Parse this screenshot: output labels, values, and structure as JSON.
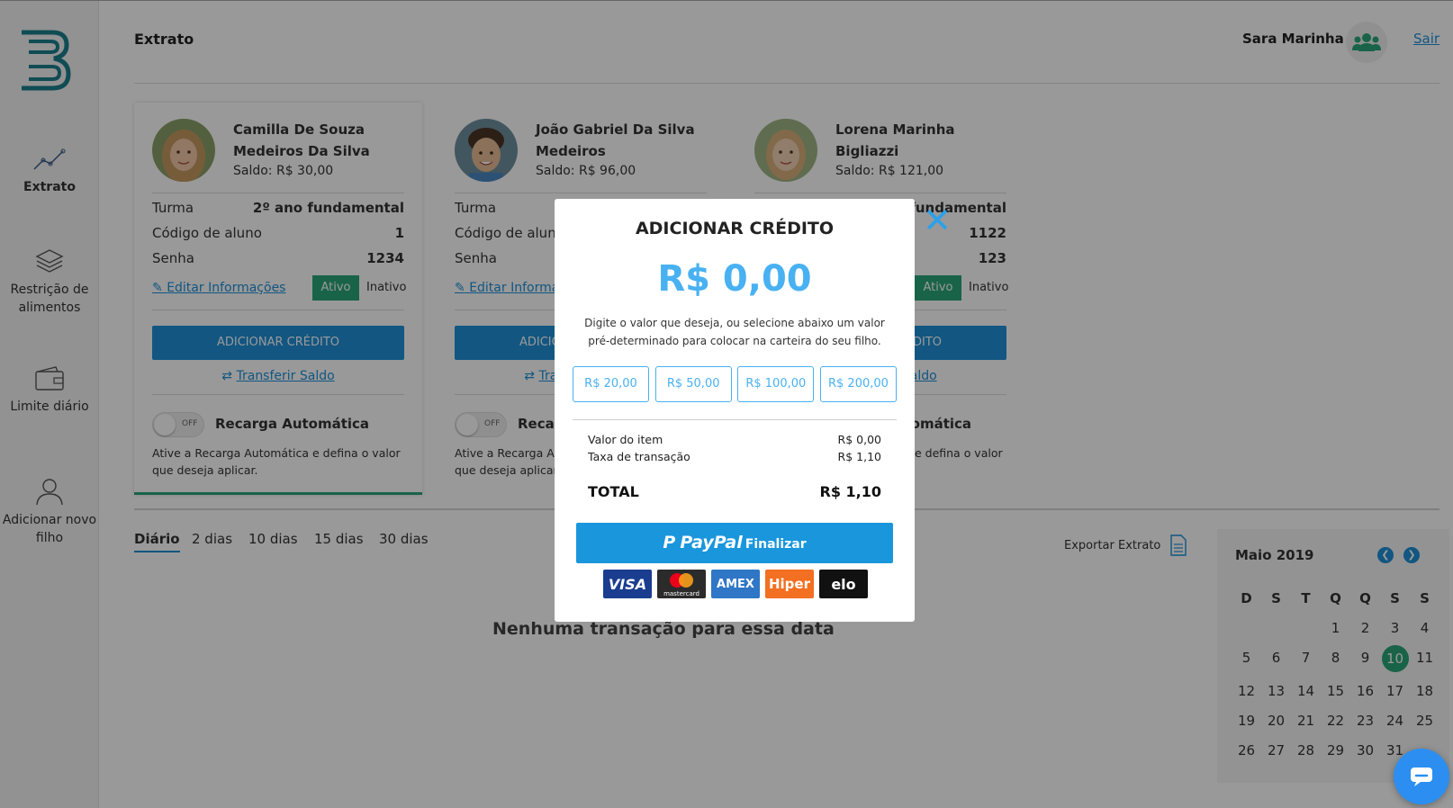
{
  "sidebar": {
    "items": [
      {
        "label": "Extrato",
        "icon": "chart-line-icon"
      },
      {
        "label": "Restrição de alimentos",
        "icon": "layers-icon"
      },
      {
        "label": "Limite diário",
        "icon": "wallet-icon"
      },
      {
        "label": "Adicionar novo filho",
        "icon": "user-icon"
      }
    ]
  },
  "header": {
    "title": "Extrato",
    "user_name": "Sara Marinha",
    "logout": "Sair"
  },
  "children": [
    {
      "name": "Camilla De Souza Medeiros Da Silva",
      "balance": "Saldo: R$ 30,00",
      "class_label": "Turma",
      "class_value": "2º ano fundamental",
      "code_label": "Código de aluno",
      "code_value": "1",
      "password_label": "Senha",
      "password_value": "1234",
      "edit_label": "Editar Informações",
      "active_label": "Ativo",
      "inactive_label": "Inativo",
      "add_credit_label": "ADICIONAR CRÉDITO",
      "transfer_label": "Transferir Saldo",
      "toggle_label": "OFF",
      "auto_title": "Recarga Automática",
      "auto_desc": "Ative a Recarga Automática e defina o valor que deseja aplicar."
    },
    {
      "name": "João Gabriel Da Silva Medeiros",
      "balance": "Saldo: R$ 96,00",
      "class_label": "Turma",
      "class_value": "",
      "code_label": "Código de aluno",
      "code_value": "",
      "password_label": "Senha",
      "password_value": "",
      "edit_label": "Editar Informações",
      "add_credit_label": "ADICIONAR CRÉDITO",
      "transfer_label": "Transferir Saldo",
      "toggle_label": "OFF",
      "auto_title": "Recarga Automática",
      "auto_desc": "Ative a Recarga Automática e defina o valor que deseja aplicar."
    },
    {
      "name": "Lorena Marinha Bigliazzi",
      "balance": "Saldo: R$ 121,00",
      "class_label": "",
      "class_value": "2º ano fundamental",
      "code_label": "",
      "code_value": "1122",
      "password_label": "",
      "password_value": "123",
      "active_label": "Ativo",
      "inactive_label": "Inativo",
      "add_credit_label": "ADICIONAR CRÉDITO",
      "transfer_label": "Transferir Saldo",
      "auto_title": "Recarga Automática",
      "auto_desc": "Ative a Recarga Automática e defina o valor que deseja aplicar."
    }
  ],
  "filters": [
    "Diário",
    "2 dias",
    "10 dias",
    "15 dias",
    "30 dias"
  ],
  "export_label": "Exportar Extrato",
  "empty_message": "Nenhuma transação para essa data",
  "calendar": {
    "title": "Maio 2019",
    "weekdays": [
      "D",
      "S",
      "T",
      "Q",
      "Q",
      "S",
      "S"
    ],
    "first_weekday_index": 3,
    "days_visible": 31,
    "selected_day": 10,
    "selected_color": "#2aa57b"
  },
  "modal": {
    "title": "ADICIONAR CRÉDITO",
    "amount": "R$ 0,00",
    "description": "Digite o valor que deseja, ou selecione abaixo um valor pré-determinado para colocar na carteira do seu filho.",
    "presets": [
      "R$ 20,00",
      "R$ 50,00",
      "R$ 100,00",
      "R$ 200,00"
    ],
    "item_label": "Valor do item",
    "item_value": "R$ 0,00",
    "fee_label": "Taxa de transação",
    "fee_value": "R$ 1,10",
    "total_label": "TOTAL",
    "total_value": "R$ 1,10",
    "paypal_label": "PayPal",
    "finalize_label": "Finalizar",
    "card_brands": [
      "VISA",
      "mastercard",
      "AMEX",
      "Hiper",
      "elo"
    ],
    "accent_color": "#48b1f2"
  },
  "colors": {
    "primary": "#1e8fd8",
    "success": "#2aa57b"
  }
}
